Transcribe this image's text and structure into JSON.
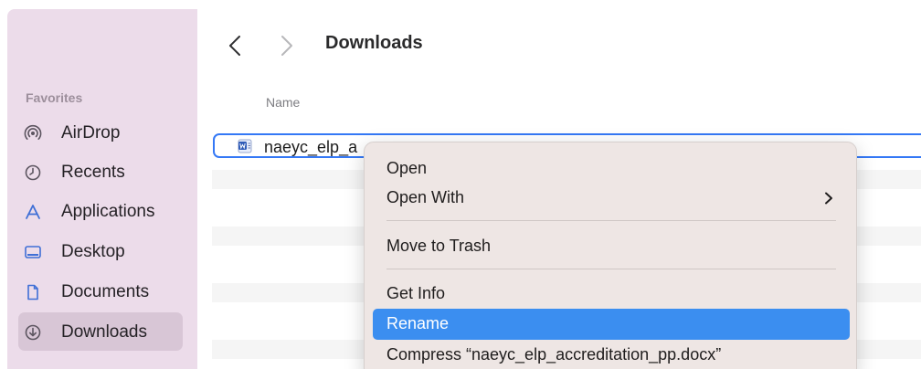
{
  "window": {
    "title": "Downloads"
  },
  "sidebar": {
    "heading": "Favorites",
    "items": [
      {
        "label": "AirDrop",
        "icon": "airdrop-icon"
      },
      {
        "label": "Recents",
        "icon": "clock-icon"
      },
      {
        "label": "Applications",
        "icon": "applications-icon"
      },
      {
        "label": "Desktop",
        "icon": "desktop-icon"
      },
      {
        "label": "Documents",
        "icon": "document-icon"
      },
      {
        "label": "Downloads",
        "icon": "download-icon",
        "selected": true
      }
    ]
  },
  "list": {
    "column_name": "Name",
    "rows": [
      {
        "name": "naeyc_elp_accreditation_pp.docx",
        "visible_name": "naeyc_elp_a",
        "icon": "word-document-icon",
        "selected": true
      }
    ]
  },
  "context_menu": {
    "items": [
      {
        "label": "Open"
      },
      {
        "label": "Open With",
        "has_submenu": true
      },
      {
        "label": "Move to Trash"
      },
      {
        "label": "Get Info"
      },
      {
        "label": "Rename",
        "highlighted": true
      },
      {
        "label": "Compress “naeyc_elp_accreditation_pp.docx”"
      }
    ]
  },
  "colors": {
    "sidebar_bg": "#ecdcea",
    "sidebar_selected": "#d8c6d6",
    "accent": "#3b8ef0",
    "selection_outline": "#3478f6",
    "menu_bg": "#eee6e4"
  }
}
